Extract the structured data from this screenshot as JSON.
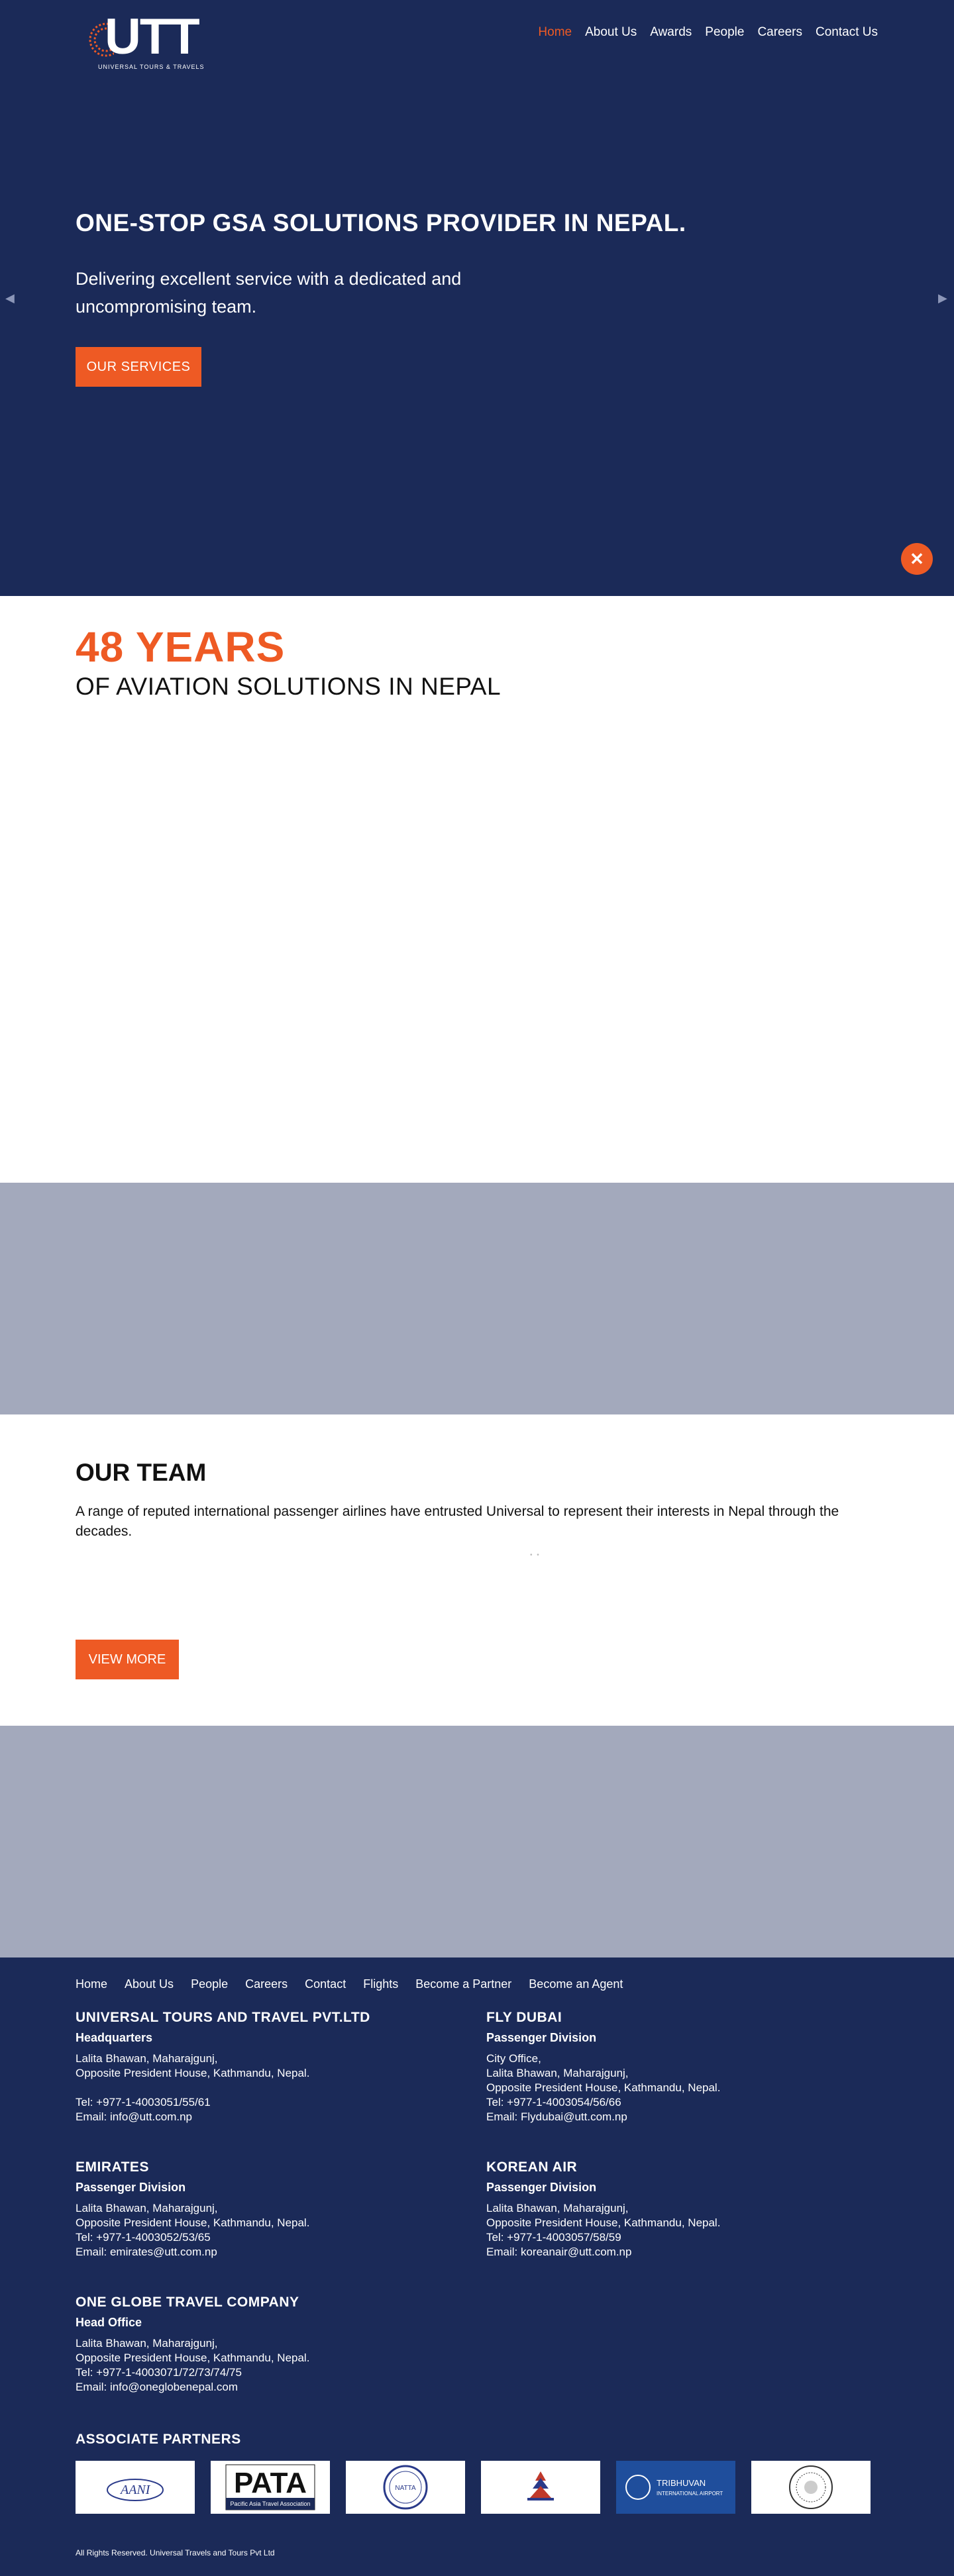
{
  "header": {
    "logo_text": "UTT",
    "logo_subtitle": "UNIVERSAL TOURS & TRAVELS",
    "nav": [
      {
        "label": "Home",
        "active": true
      },
      {
        "label": "About Us",
        "active": false
      },
      {
        "label": "Awards",
        "active": false
      },
      {
        "label": "People",
        "active": false
      },
      {
        "label": "Careers",
        "active": false
      },
      {
        "label": "Contact Us",
        "active": false
      }
    ]
  },
  "hero": {
    "title": "ONE-STOP GSA SOLUTIONS PROVIDER IN NEPAL.",
    "subtitle": "Delivering excellent service with a dedicated and uncompromising team.",
    "button": "OUR SERVICES",
    "prev_icon": "chevron-left-icon",
    "next_icon": "chevron-right-icon",
    "close_icon": "close-icon"
  },
  "years": {
    "number": "48 YEARS",
    "text": "OF AVIATION SOLUTIONS IN NEPAL"
  },
  "team": {
    "title": "OUR TEAM",
    "description": "A range of reputed international passenger airlines have entrusted Universal to represent their interests in Nepal through the decades.",
    "button": "VIEW MORE"
  },
  "footer": {
    "nav": [
      "Home",
      "About Us",
      "People",
      "Careers",
      "Contact",
      "Flights",
      "Become a Partner",
      "Become an Agent"
    ],
    "offices": {
      "utt": {
        "title": "UNIVERSAL TOURS AND TRAVEL PVT.LTD",
        "division": "Headquarters",
        "line1": "Lalita Bhawan, Maharajgunj,",
        "line2": "Opposite President House, Kathmandu, Nepal.",
        "tel": "Tel: +977-1-4003051/55/61",
        "email": "Email: info@utt.com.np"
      },
      "flydubai": {
        "title": "FLY DUBAI",
        "division": "Passenger Division",
        "line0": "City Office,",
        "line1": "Lalita Bhawan, Maharajgunj,",
        "line2": "Opposite President House, Kathmandu, Nepal.",
        "tel": "Tel: +977-1-4003054/56/66",
        "email": "Email: Flydubai@utt.com.np"
      },
      "emirates": {
        "title": "EMIRATES",
        "division": "Passenger Division",
        "line1": "Lalita Bhawan, Maharajgunj,",
        "line2": "Opposite President House, Kathmandu, Nepal.",
        "tel": "Tel: +977-1-4003052/53/65",
        "email": "Email: emirates@utt.com.np"
      },
      "korean": {
        "title": "KOREAN AIR",
        "division": "Passenger Division",
        "line1": "Lalita Bhawan, Maharajgunj,",
        "line2": "Opposite President House, Kathmandu, Nepal.",
        "tel": "Tel: +977-1-4003057/58/59",
        "email": "Email: koreanair@utt.com.np"
      },
      "oneglobe": {
        "title": "ONE GLOBE TRAVEL COMPANY",
        "division": "Head Office",
        "line1": "Lalita Bhawan, Maharajgunj,",
        "line2": "Opposite President House, Kathmandu, Nepal.",
        "tel": "Tel: +977-1-4003071/72/73/74/75",
        "email": "Email: info@oneglobenepal.com"
      }
    },
    "partners_title": "ASSOCIATE PARTNERS",
    "partners": [
      {
        "name": "AANI",
        "icon": "aani-logo"
      },
      {
        "name": "PATA",
        "tagline": "Pacific Asia Travel Association",
        "icon": "pata-logo"
      },
      {
        "name": "NATTA",
        "icon": "natta-logo"
      },
      {
        "name": "",
        "icon": "nepal-tourism-logo"
      },
      {
        "name": "TRIBHUVAN",
        "tagline": "INTERNATIONAL AIRPORT",
        "icon": "tia-logo"
      },
      {
        "name": "",
        "icon": "seal-logo"
      }
    ],
    "copyright": "All Rights Reserved. Universal Travels and Tours Pvt Ltd"
  },
  "colors": {
    "navy": "#1b2a58",
    "accent": "#ee5a24",
    "band": "#a3a9bc"
  }
}
